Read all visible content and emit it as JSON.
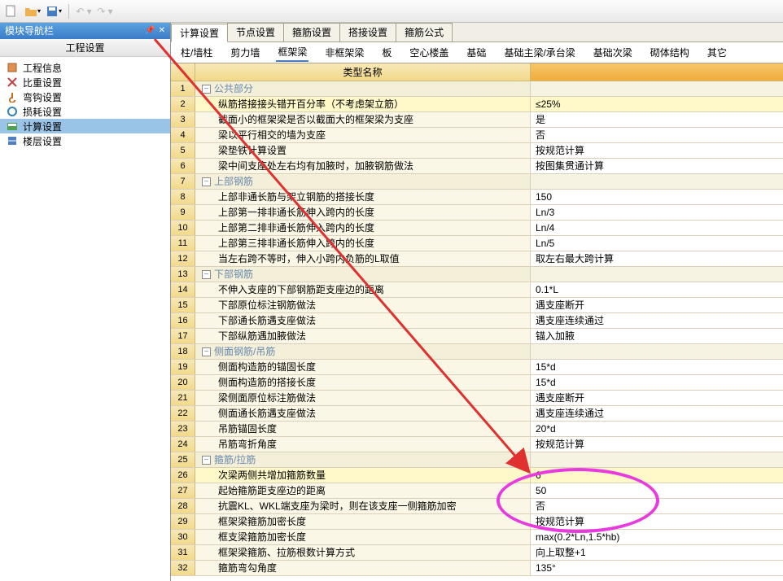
{
  "sidebar": {
    "title": "模块导航栏",
    "subhead": "工程设置",
    "items": [
      {
        "label": "工程信息"
      },
      {
        "label": "比重设置"
      },
      {
        "label": "弯钩设置"
      },
      {
        "label": "损耗设置"
      },
      {
        "label": "计算设置"
      },
      {
        "label": "楼层设置"
      }
    ]
  },
  "tabs_top": [
    "计算设置",
    "节点设置",
    "箍筋设置",
    "搭接设置",
    "箍筋公式"
  ],
  "tabs_sub": [
    "柱/墙柱",
    "剪力墙",
    "框架梁",
    "非框架梁",
    "板",
    "空心楼盖",
    "基础",
    "基础主梁/承台梁",
    "基础次梁",
    "砌体结构",
    "其它"
  ],
  "grid_header": {
    "name": "类型名称",
    "val": ""
  },
  "rows": [
    {
      "n": "1",
      "type": "section",
      "label": "公共部分",
      "val": ""
    },
    {
      "n": "2",
      "indent": 1,
      "label": "纵筋搭接接头错开百分率（不考虑架立筋）",
      "val": "≤25%",
      "hl": 1
    },
    {
      "n": "3",
      "indent": 1,
      "label": "截面小的框架梁是否以截面大的框架梁为支座",
      "val": "是"
    },
    {
      "n": "4",
      "indent": 1,
      "label": "梁以平行相交的墙为支座",
      "val": "否"
    },
    {
      "n": "5",
      "indent": 1,
      "label": "梁垫铁计算设置",
      "val": "按规范计算"
    },
    {
      "n": "6",
      "indent": 1,
      "label": "梁中间支座处左右均有加腋时，加腋钢筋做法",
      "val": "按图集贯通计算"
    },
    {
      "n": "7",
      "type": "section",
      "label": "上部钢筋",
      "val": ""
    },
    {
      "n": "8",
      "indent": 1,
      "label": "上部非通长筋与架立钢筋的搭接长度",
      "val": "150"
    },
    {
      "n": "9",
      "indent": 1,
      "label": "上部第一排非通长筋伸入跨内的长度",
      "val": "Ln/3"
    },
    {
      "n": "10",
      "indent": 1,
      "label": "上部第二排非通长筋伸入跨内的长度",
      "val": "Ln/4"
    },
    {
      "n": "11",
      "indent": 1,
      "label": "上部第三排非通长筋伸入跨内的长度",
      "val": "Ln/5"
    },
    {
      "n": "12",
      "indent": 1,
      "label": "当左右跨不等时，伸入小跨内负筋的L取值",
      "val": "取左右最大跨计算"
    },
    {
      "n": "13",
      "type": "section",
      "label": "下部钢筋",
      "val": ""
    },
    {
      "n": "14",
      "indent": 1,
      "label": "不伸入支座的下部钢筋距支座边的距离",
      "val": "0.1*L"
    },
    {
      "n": "15",
      "indent": 1,
      "label": "下部原位标注钢筋做法",
      "val": "遇支座断开"
    },
    {
      "n": "16",
      "indent": 1,
      "label": "下部通长筋遇支座做法",
      "val": "遇支座连续通过"
    },
    {
      "n": "17",
      "indent": 1,
      "label": "下部纵筋遇加腋做法",
      "val": "锚入加腋"
    },
    {
      "n": "18",
      "type": "section",
      "label": "侧面钢筋/吊筋",
      "val": ""
    },
    {
      "n": "19",
      "indent": 1,
      "label": "侧面构造筋的锚固长度",
      "val": "15*d"
    },
    {
      "n": "20",
      "indent": 1,
      "label": "侧面构造筋的搭接长度",
      "val": "15*d"
    },
    {
      "n": "21",
      "indent": 1,
      "label": "梁侧面原位标注筋做法",
      "val": "遇支座断开"
    },
    {
      "n": "22",
      "indent": 1,
      "label": "侧面通长筋遇支座做法",
      "val": "遇支座连续通过"
    },
    {
      "n": "23",
      "indent": 1,
      "label": "吊筋锚固长度",
      "val": "20*d"
    },
    {
      "n": "24",
      "indent": 1,
      "label": "吊筋弯折角度",
      "val": "按规范计算"
    },
    {
      "n": "25",
      "type": "section",
      "label": "箍筋/拉筋",
      "val": ""
    },
    {
      "n": "26",
      "indent": 1,
      "label": "次梁两侧共增加箍筋数量",
      "val": "6",
      "hl": 1
    },
    {
      "n": "27",
      "indent": 1,
      "label": "起始箍筋距支座边的距离",
      "val": "50"
    },
    {
      "n": "28",
      "indent": 1,
      "label": "抗震KL、WKL端支座为梁时，则在该支座一侧箍筋加密",
      "val": "否"
    },
    {
      "n": "29",
      "indent": 1,
      "label": "框架梁箍筋加密长度",
      "val": "按规范计算"
    },
    {
      "n": "30",
      "indent": 1,
      "label": "框支梁箍筋加密长度",
      "val": "max(0.2*Ln,1.5*hb)"
    },
    {
      "n": "31",
      "indent": 1,
      "label": "框架梁箍筋、拉筋根数计算方式",
      "val": "向上取整+1"
    },
    {
      "n": "32",
      "indent": 1,
      "label": "箍筋弯勾角度",
      "val": "135°"
    }
  ]
}
